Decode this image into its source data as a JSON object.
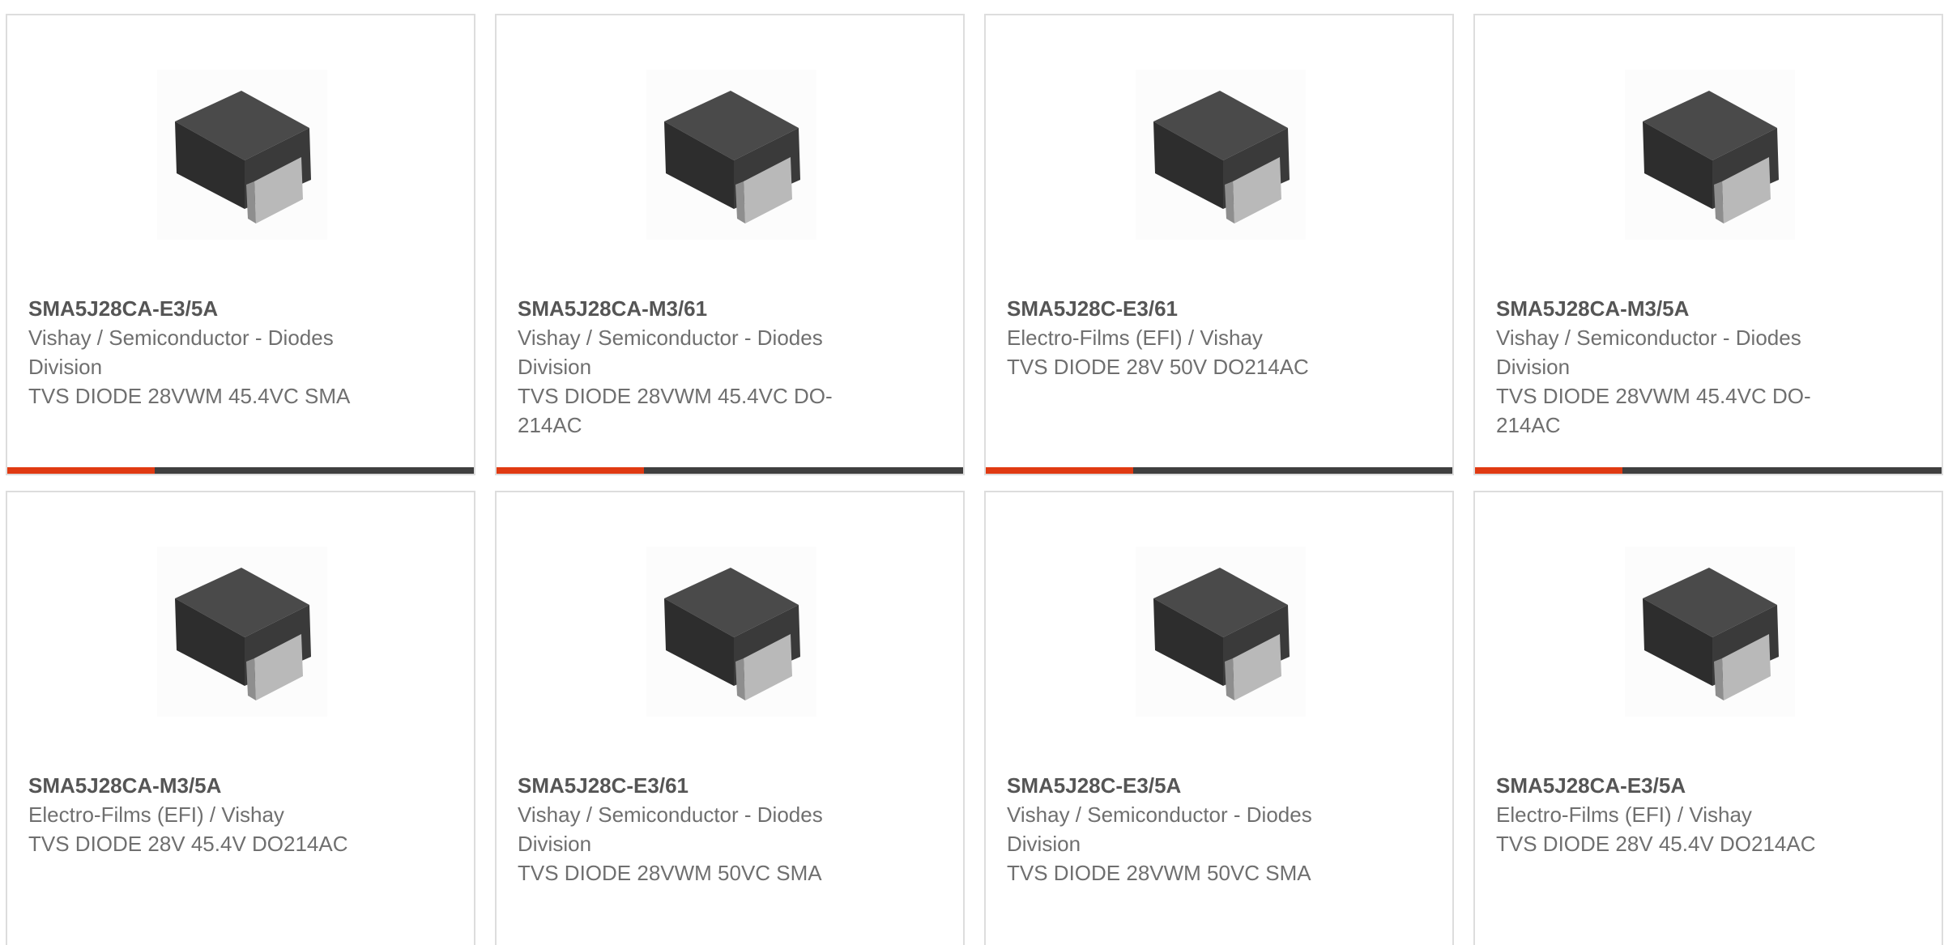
{
  "colors": {
    "accent": "#e03a12",
    "bar": "#3f3f3f",
    "border": "#dddddd",
    "text": "#6f6f6f"
  },
  "products": [
    {
      "part_number": "SMA5J28CA-E3/5A",
      "manufacturer": "Vishay / Semiconductor - Diodes Division",
      "description": "TVS DIODE 28VWM 45.4VC SMA",
      "image_icon": "diode-package-icon"
    },
    {
      "part_number": "SMA5J28CA-M3/61",
      "manufacturer": "Vishay / Semiconductor - Diodes Division",
      "description": "TVS DIODE 28VWM 45.4VC DO-214AC",
      "image_icon": "diode-package-icon"
    },
    {
      "part_number": "SMA5J28C-E3/61",
      "manufacturer": "Electro-Films (EFI) / Vishay",
      "description": "TVS DIODE 28V 50V DO214AC",
      "image_icon": "diode-package-icon"
    },
    {
      "part_number": "SMA5J28CA-M3/5A",
      "manufacturer": "Vishay / Semiconductor - Diodes Division",
      "description": "TVS DIODE 28VWM 45.4VC DO-214AC",
      "image_icon": "diode-package-icon"
    },
    {
      "part_number": "SMA5J28CA-M3/5A",
      "manufacturer": "Electro-Films (EFI) / Vishay",
      "description": "TVS DIODE 28V 45.4V DO214AC",
      "image_icon": "diode-package-icon"
    },
    {
      "part_number": "SMA5J28C-E3/61",
      "manufacturer": "Vishay / Semiconductor - Diodes Division",
      "description": "TVS DIODE 28VWM 50VC SMA",
      "image_icon": "diode-package-icon"
    },
    {
      "part_number": "SMA5J28C-E3/5A",
      "manufacturer": "Vishay / Semiconductor - Diodes Division",
      "description": "TVS DIODE 28VWM 50VC SMA",
      "image_icon": "diode-package-icon"
    },
    {
      "part_number": "SMA5J28CA-E3/5A",
      "manufacturer": "Electro-Films (EFI) / Vishay",
      "description": "TVS DIODE 28V 45.4V DO214AC",
      "image_icon": "diode-package-icon"
    }
  ]
}
